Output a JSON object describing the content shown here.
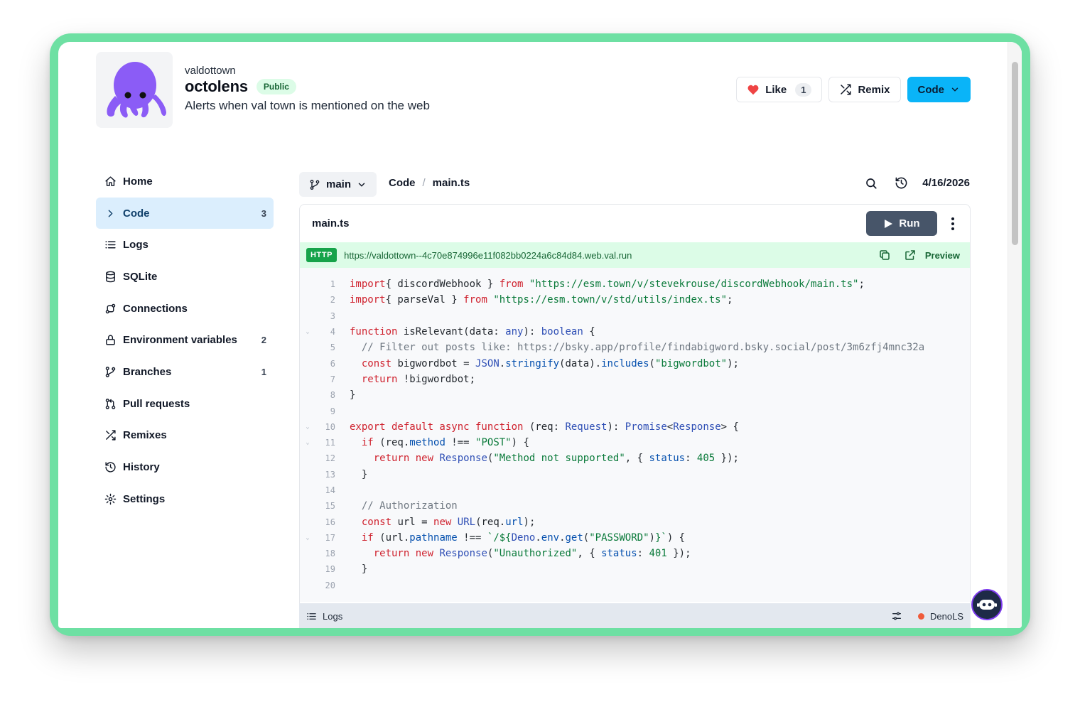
{
  "header": {
    "owner": "valdottown",
    "val_name": "octolens",
    "visibility": "Public",
    "description": "Alerts when val town is mentioned on the web",
    "avatar_icon": "octopus-icon",
    "like_label": "Like",
    "like_count": "1",
    "remix_label": "Remix",
    "code_label": "Code"
  },
  "sidebar": {
    "items": [
      {
        "label": "Home",
        "icon": "home-icon",
        "count": ""
      },
      {
        "label": "Code",
        "icon": "chevron-right-icon",
        "count": "3",
        "active": true
      },
      {
        "label": "Logs",
        "icon": "list-icon",
        "count": ""
      },
      {
        "label": "SQLite",
        "icon": "database-icon",
        "count": ""
      },
      {
        "label": "Connections",
        "icon": "connections-icon",
        "count": ""
      },
      {
        "label": "Environment variables",
        "icon": "lock-icon",
        "count": "2"
      },
      {
        "label": "Branches",
        "icon": "branch-icon",
        "count": "1"
      },
      {
        "label": "Pull requests",
        "icon": "pull-request-icon",
        "count": ""
      },
      {
        "label": "Remixes",
        "icon": "shuffle-icon",
        "count": ""
      },
      {
        "label": "History",
        "icon": "history-icon",
        "count": ""
      },
      {
        "label": "Settings",
        "icon": "gear-icon",
        "count": ""
      }
    ]
  },
  "editor": {
    "branch": "main",
    "breadcrumb_root": "Code",
    "breadcrumb_sep": "/",
    "breadcrumb_file": "main.ts",
    "last_modified": "4/16/2026",
    "file_name": "main.ts",
    "run_label": "Run",
    "http_badge": "HTTP",
    "http_url": "https://valdottown--4c70e874996e11f082bb0224a6c84d84.web.val.run",
    "preview_label": "Preview",
    "lines": [
      {
        "n": "1",
        "fold": false,
        "tokens": [
          [
            "kw",
            "import"
          ],
          [
            "",
            "{ discordWebhook } "
          ],
          [
            "kw",
            "from"
          ],
          [
            "",
            " "
          ],
          [
            "str",
            "\"https://esm.town/v/stevekrouse/discordWebhook/main.ts\""
          ],
          [
            "",
            ";"
          ]
        ]
      },
      {
        "n": "2",
        "fold": false,
        "tokens": [
          [
            "kw",
            "import"
          ],
          [
            "",
            "{ parseVal } "
          ],
          [
            "kw",
            "from"
          ],
          [
            "",
            " "
          ],
          [
            "str",
            "\"https://esm.town/v/std/utils/index.ts\""
          ],
          [
            "",
            ";"
          ]
        ]
      },
      {
        "n": "3",
        "fold": false,
        "tokens": []
      },
      {
        "n": "4",
        "fold": true,
        "tokens": [
          [
            "kw",
            "function"
          ],
          [
            "",
            " isRelevant(data: "
          ],
          [
            "ty",
            "any"
          ],
          [
            "",
            "): "
          ],
          [
            "ty",
            "boolean"
          ],
          [
            "",
            " {"
          ]
        ]
      },
      {
        "n": "5",
        "fold": false,
        "tokens": [
          [
            "",
            "  "
          ],
          [
            "cm",
            "// Filter out posts like: https://bsky.app/profile/findabigword.bsky.social/post/3m6zfj4mnc32a"
          ]
        ]
      },
      {
        "n": "6",
        "fold": false,
        "tokens": [
          [
            "",
            "  "
          ],
          [
            "kw",
            "const"
          ],
          [
            "",
            " bigwordbot = "
          ],
          [
            "ty",
            "JSON"
          ],
          [
            "",
            "."
          ],
          [
            "pr",
            "stringify"
          ],
          [
            "",
            "(data)."
          ],
          [
            "pr",
            "includes"
          ],
          [
            "",
            "("
          ],
          [
            "str",
            "\"bigwordbot\""
          ],
          [
            "",
            ");"
          ]
        ]
      },
      {
        "n": "7",
        "fold": false,
        "tokens": [
          [
            "",
            "  "
          ],
          [
            "kw",
            "return"
          ],
          [
            "",
            " !bigwordbot;"
          ]
        ]
      },
      {
        "n": "8",
        "fold": false,
        "tokens": [
          [
            "",
            "}"
          ]
        ]
      },
      {
        "n": "9",
        "fold": false,
        "tokens": []
      },
      {
        "n": "10",
        "fold": true,
        "tokens": [
          [
            "kw",
            "export default async function"
          ],
          [
            "",
            " (req: "
          ],
          [
            "ty",
            "Request"
          ],
          [
            "",
            "): "
          ],
          [
            "ty",
            "Promise"
          ],
          [
            "",
            "<"
          ],
          [
            "ty",
            "Response"
          ],
          [
            "",
            "> {"
          ]
        ]
      },
      {
        "n": "11",
        "fold": true,
        "tokens": [
          [
            "",
            "  "
          ],
          [
            "kw",
            "if"
          ],
          [
            "",
            " (req."
          ],
          [
            "pr",
            "method"
          ],
          [
            "",
            " !== "
          ],
          [
            "str",
            "\"POST\""
          ],
          [
            "",
            ") {"
          ]
        ]
      },
      {
        "n": "12",
        "fold": false,
        "tokens": [
          [
            "",
            "    "
          ],
          [
            "kw",
            "return new"
          ],
          [
            "",
            " "
          ],
          [
            "ty",
            "Response"
          ],
          [
            "",
            "("
          ],
          [
            "str",
            "\"Method not supported\""
          ],
          [
            "",
            ", { "
          ],
          [
            "pr",
            "status"
          ],
          [
            "",
            ": "
          ],
          [
            "num",
            "405"
          ],
          [
            "",
            " });"
          ]
        ]
      },
      {
        "n": "13",
        "fold": false,
        "tokens": [
          [
            "",
            "  }"
          ]
        ]
      },
      {
        "n": "14",
        "fold": false,
        "tokens": []
      },
      {
        "n": "15",
        "fold": false,
        "tokens": [
          [
            "",
            "  "
          ],
          [
            "cm",
            "// Authorization"
          ]
        ]
      },
      {
        "n": "16",
        "fold": false,
        "tokens": [
          [
            "",
            "  "
          ],
          [
            "kw",
            "const"
          ],
          [
            "",
            " url = "
          ],
          [
            "kw",
            "new"
          ],
          [
            "",
            " "
          ],
          [
            "ty",
            "URL"
          ],
          [
            "",
            "(req."
          ],
          [
            "pr",
            "url"
          ],
          [
            "",
            ");"
          ]
        ]
      },
      {
        "n": "17",
        "fold": true,
        "tokens": [
          [
            "",
            "  "
          ],
          [
            "kw",
            "if"
          ],
          [
            "",
            " (url."
          ],
          [
            "pr",
            "pathname"
          ],
          [
            "",
            " !== "
          ],
          [
            "str",
            "`/${"
          ],
          [
            "ty",
            "Deno"
          ],
          [
            "",
            "."
          ],
          [
            "pr",
            "env"
          ],
          [
            "",
            "."
          ],
          [
            "pr",
            "get"
          ],
          [
            "",
            "("
          ],
          [
            "str",
            "\"PASSWORD\""
          ],
          [
            "",
            ")"
          ],
          [
            "str",
            "}`"
          ],
          [
            "",
            ") {"
          ]
        ]
      },
      {
        "n": "18",
        "fold": false,
        "tokens": [
          [
            "",
            "    "
          ],
          [
            "kw",
            "return new"
          ],
          [
            "",
            " "
          ],
          [
            "ty",
            "Response"
          ],
          [
            "",
            "("
          ],
          [
            "str",
            "\"Unauthorized\""
          ],
          [
            "",
            ", { "
          ],
          [
            "pr",
            "status"
          ],
          [
            "",
            ": "
          ],
          [
            "num",
            "401"
          ],
          [
            "",
            " });"
          ]
        ]
      },
      {
        "n": "19",
        "fold": false,
        "tokens": [
          [
            "",
            "  }"
          ]
        ]
      },
      {
        "n": "20",
        "fold": false,
        "tokens": []
      }
    ]
  },
  "status_bar": {
    "logs_label": "Logs",
    "lsp_label": "DenoLS"
  },
  "colors": {
    "accent": "#0ab4f8",
    "frame": "#6ee0a3",
    "active_nav": "#dbeefd",
    "http_bar": "#dcfce7",
    "run_button": "#475569"
  }
}
